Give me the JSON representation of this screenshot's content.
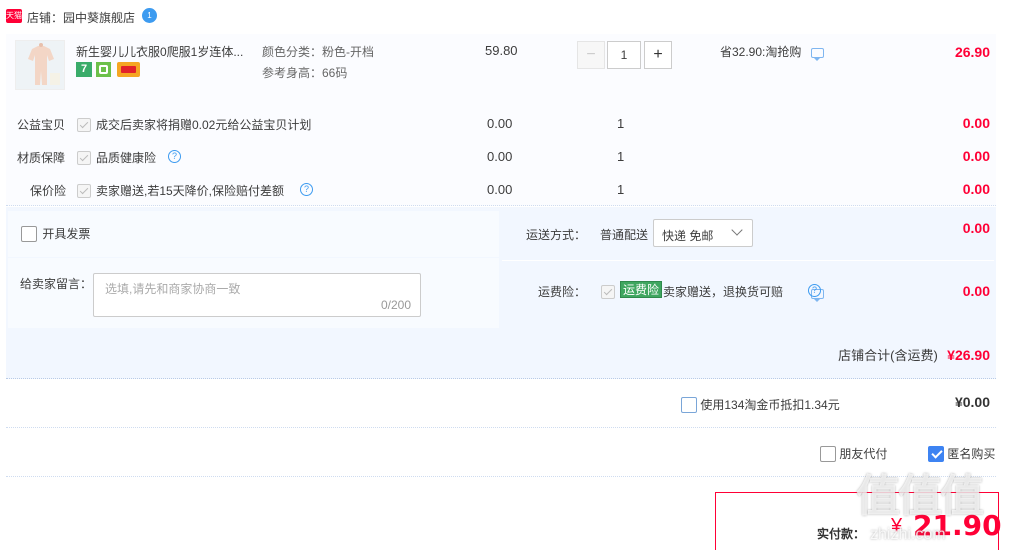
{
  "shop": {
    "badge": "天猫",
    "label": "店铺：园中葵旗舰店",
    "msg_count": "1"
  },
  "item": {
    "title": "新生婴儿儿衣服0爬服1岁连体...",
    "sku1": "颜色分类：粉色-开档",
    "sku2": "参考身高：66码",
    "price": "59.80",
    "qty": "1",
    "minus": "−",
    "plus": "+",
    "promo": "省32.90:淘抢购",
    "total": "26.90",
    "badge_7": "7"
  },
  "services": [
    {
      "label": "公益宝贝",
      "desc": "成交后卖家将捐赠0.02元给公益宝贝计划",
      "price": "0.00",
      "qty": "1",
      "total": "0.00",
      "help": false
    },
    {
      "label": "材质保障",
      "desc": "品质健康险",
      "price": "0.00",
      "qty": "1",
      "total": "0.00",
      "help": true
    },
    {
      "label": "保价险",
      "desc": "卖家赠送,若15天降价,保险赔付差额",
      "price": "0.00",
      "qty": "1",
      "total": "0.00",
      "help": true
    }
  ],
  "invoice": {
    "label": "开具发票"
  },
  "message": {
    "label": "给卖家留言：",
    "placeholder": "选填,请先和商家协商一致",
    "counter": "0/200"
  },
  "shipping": {
    "label": "运送方式：",
    "type": "普通配送",
    "option": "快递 免邮",
    "cost": "0.00"
  },
  "insurance": {
    "label": "运费险：",
    "tag": "运费险",
    "desc": "卖家赠送，退换货可赔",
    "cost": "0.00"
  },
  "shop_total": {
    "label": "店铺合计(含运费)",
    "value": "¥26.90"
  },
  "coins": {
    "label": "使用134淘金币抵扣1.34元",
    "value": "¥0.00"
  },
  "options": {
    "friend_pay": "朋友代付",
    "anonymous": "匿名购买"
  },
  "final": {
    "label": "实付款：",
    "currency": "¥",
    "value": "21.90"
  },
  "watermark": {
    "cn": "值值值",
    "url": "zhizhi.com"
  },
  "colors": {
    "accent_red": "#ff0036",
    "row_bg": "#fbfcff",
    "section_bg": "#f2f7ff",
    "link_blue": "#3d83f2"
  }
}
